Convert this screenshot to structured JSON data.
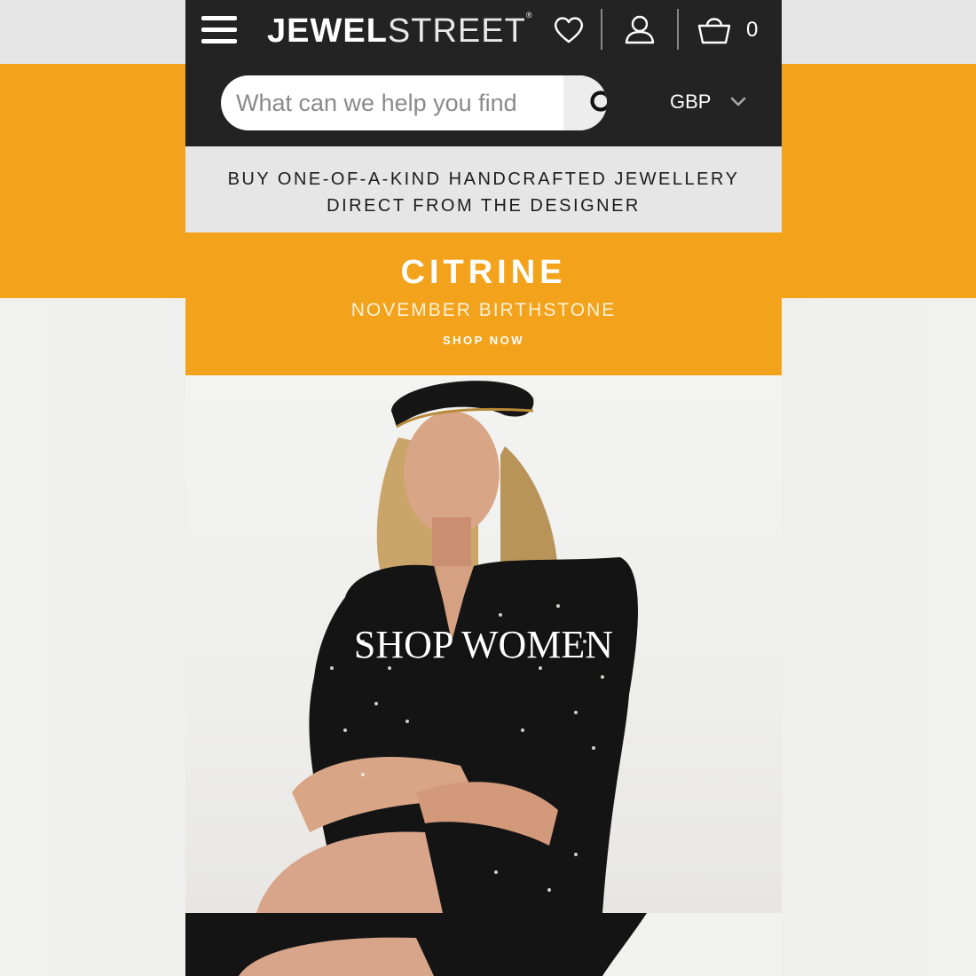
{
  "header": {
    "logo_bold": "JEWEL",
    "logo_light": "STREET",
    "logo_mark": "®",
    "cart_count": "0",
    "icons": {
      "menu": "hamburger-menu-icon",
      "wishlist": "heart-icon",
      "account": "user-icon",
      "cart": "basket-icon",
      "search": "search-icon",
      "currency_toggle": "chevron-down-icon"
    }
  },
  "search": {
    "placeholder": "What can we help you find"
  },
  "currency": {
    "selected": "GBP"
  },
  "tagline": {
    "line1": "BUY ONE-OF-A-KIND HANDCRAFTED JEWELLERY",
    "line2": "DIRECT FROM THE DESIGNER"
  },
  "promo": {
    "title": "CITRINE",
    "subtitle": "NOVEMBER BIRTHSTONE",
    "cta": "SHOP NOW"
  },
  "hero": {
    "label": "SHOP WOMEN"
  },
  "colors": {
    "header_bg": "#232323",
    "accent_orange": "#f2a31b",
    "tagline_bg": "#e6e6e6",
    "white": "#ffffff"
  }
}
